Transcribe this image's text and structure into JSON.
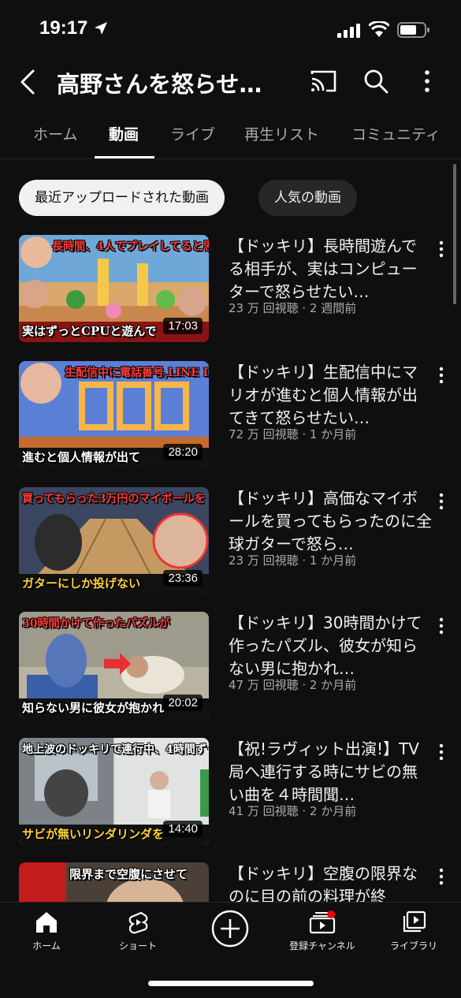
{
  "status_bar": {
    "time": "19:17"
  },
  "header": {
    "title": "高野さんを怒らせ…"
  },
  "tabs": [
    {
      "label": "ホーム"
    },
    {
      "label": "動画"
    },
    {
      "label": "ライブ"
    },
    {
      "label": "再生リスト"
    },
    {
      "label": "コミュニティ"
    }
  ],
  "active_tab": "動画",
  "chips": [
    {
      "label": "最近アップロードされた動画"
    },
    {
      "label": "人気の動画"
    }
  ],
  "videos": [
    {
      "title": "【ドッキリ】長時間遊んでる相手が、実はコンピューターで怒らせたい…",
      "meta": "23 万 回視聴 · 2 週間前",
      "duration": "17:03",
      "thumb_top": "長時間、4人でプレイしてると思ったら",
      "thumb_bottom": "実はずっとCPUと遊んで"
    },
    {
      "title": "【ドッキリ】生配信中にマリオが進むと個人情報が出てきて怒らせたい…",
      "meta": "72 万 回視聴 · 1 か月前",
      "duration": "28:20",
      "thumb_top": "生配信中に電話番号,LINE ID...",
      "thumb_bottom": "進むと個人情報が出て"
    },
    {
      "title": "【ドッキリ】高価なマイボールを買ってもらったのに全球ガターで怒ら…",
      "meta": "23 万 回視聴 · 1 か月前",
      "duration": "23:36",
      "thumb_top": "買ってもらった3万円のマイボールを",
      "thumb_bottom": "ガターにしか投げない"
    },
    {
      "title": "【ドッキリ】30時間かけて作ったパズル、彼女が知らない男に抱かれ…",
      "meta": "47 万 回視聴 · 2 か月前",
      "duration": "20:02",
      "thumb_top": "30時間かけて作ったパズルが",
      "thumb_bottom": "知らない男に彼女が抱かれ"
    },
    {
      "title": "【祝!ラヴィット出演!】TV局へ連行する時にサビの無い曲を４時間聞…",
      "meta": "41 万 回視聴 · 2 か月前",
      "duration": "14:40",
      "thumb_top": "地上波のドッキリで連行中、4時間ずっと",
      "thumb_bottom": "サビが無いリンダリンダを"
    },
    {
      "title": "【ドッキリ】空腹の限界なのに目の前の料理が終",
      "meta": "",
      "duration": "",
      "thumb_top": "限界まで空腹にさせて",
      "thumb_bottom": ""
    }
  ],
  "bottom_nav": [
    {
      "label": "ホーム"
    },
    {
      "label": "ショート"
    },
    {
      "label": ""
    },
    {
      "label": "登録チャンネル"
    },
    {
      "label": "ライブラリ"
    }
  ],
  "colors": {
    "background": "#0f0f0f",
    "text_primary": "#f1f1f1",
    "text_secondary": "#aaaaaa",
    "chip_active_bg": "#f1f1f1",
    "chip_inactive_bg": "#272727",
    "badge_red": "#ff0000"
  }
}
